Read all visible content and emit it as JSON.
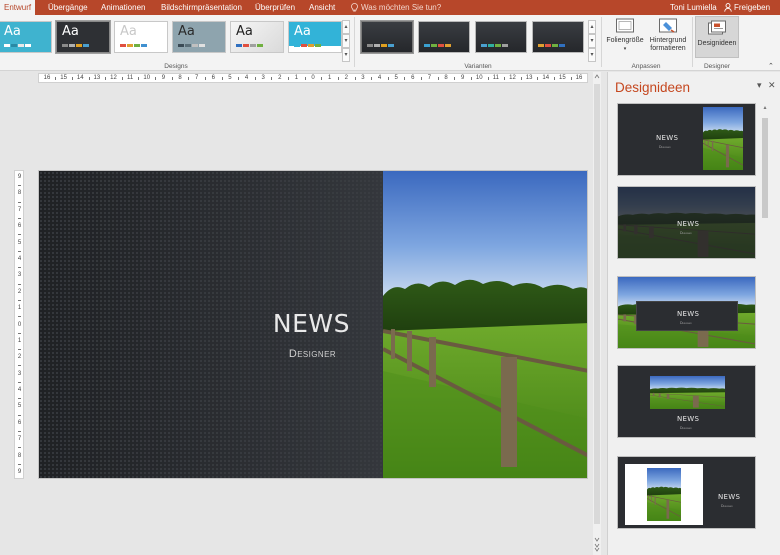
{
  "tabs": [
    {
      "label": "Entwurf",
      "active": true
    },
    {
      "label": "Übergänge"
    },
    {
      "label": "Animationen"
    },
    {
      "label": "Bildschirmpräsentation"
    },
    {
      "label": "Überprüfen"
    },
    {
      "label": "Ansicht"
    }
  ],
  "tell_me": {
    "placeholder": "Was möchten Sie tun?",
    "icon": "lightbulb-icon"
  },
  "user": {
    "name": "Toni Lumiella"
  },
  "share": {
    "label": "Freigeben",
    "icon": "person-icon"
  },
  "ribbon": {
    "groups": {
      "designs": "Designs",
      "variants": "Varianten",
      "customize": "Anpassen",
      "designer": "Designer"
    },
    "buttons": {
      "slide_size": "Foliengröße",
      "format_background_1": "Hintergrund",
      "format_background_2": "formatieren",
      "design_ideas": "Designideen"
    },
    "theme_glyph": "Aa"
  },
  "ruler": {
    "horizontal": [
      "16",
      "15",
      "14",
      "13",
      "12",
      "11",
      "10",
      "9",
      "8",
      "7",
      "6",
      "5",
      "4",
      "3",
      "2",
      "1",
      "0",
      "1",
      "2",
      "3",
      "4",
      "5",
      "6",
      "7",
      "8",
      "9",
      "10",
      "11",
      "12",
      "13",
      "14",
      "15",
      "16"
    ],
    "vertical": [
      "9",
      "8",
      "7",
      "6",
      "5",
      "4",
      "3",
      "2",
      "1",
      "0",
      "1",
      "2",
      "3",
      "4",
      "5",
      "6",
      "7",
      "8",
      "9"
    ]
  },
  "slide": {
    "title": "NEWS",
    "subtitle": "Designer"
  },
  "pane": {
    "title": "Designideen",
    "thumbnails": [
      {
        "title": "NEWS",
        "subtitle": "Designer"
      },
      {
        "title": "NEWS",
        "subtitle": "Designer"
      },
      {
        "title": "NEWS",
        "subtitle": "Designer"
      },
      {
        "title": "NEWS",
        "subtitle": "Designer"
      },
      {
        "title": "NEWS",
        "subtitle": "Designer"
      }
    ]
  },
  "colors": {
    "accent": "#b7472a",
    "pane_title": "#c5471f",
    "ribbon_bg": "#f3f3f3",
    "canvas_bg": "#e6e6e6",
    "slide_dark": "#2b2d31",
    "grass": "#5a9a22",
    "sky": "#4a7fd0"
  }
}
